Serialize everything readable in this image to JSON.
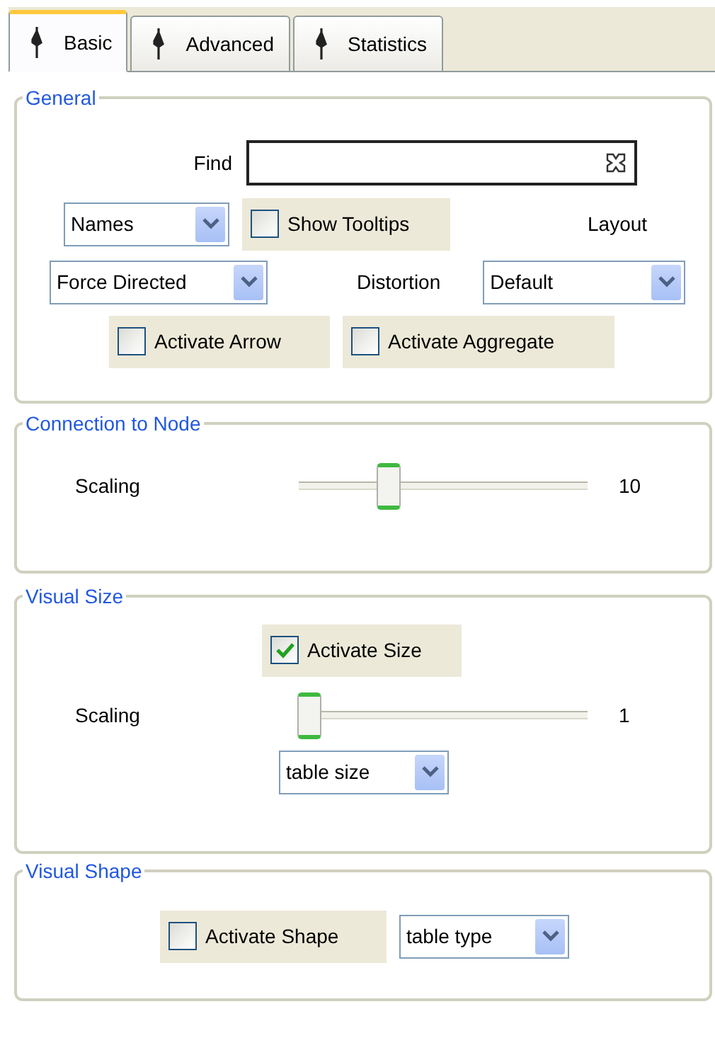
{
  "tabs": [
    {
      "label": "Basic",
      "selected": true
    },
    {
      "label": "Advanced",
      "selected": false
    },
    {
      "label": "Statistics",
      "selected": false
    }
  ],
  "general": {
    "title": "General",
    "find_label": "Find",
    "names_select": "Names",
    "show_tooltips": {
      "label": "Show Tooltips",
      "checked": false
    },
    "layout_label": "Layout",
    "layout_select": "Force Directed",
    "distortion_label": "Distortion",
    "distortion_select": "Default",
    "activate_arrow": {
      "label": "Activate Arrow",
      "checked": false
    },
    "activate_aggregate": {
      "label": "Activate Aggregate",
      "checked": false
    }
  },
  "connection": {
    "title": "Connection to Node",
    "scaling_label": "Scaling",
    "slider": {
      "level": 0.3
    },
    "reading": "10"
  },
  "visual_size": {
    "title": "Visual Size",
    "activate_size": {
      "label": "Activate Size",
      "checked": true
    },
    "scaling_label": "Scaling",
    "slider": {
      "level": 0
    },
    "reading": "1",
    "size_select": "table size"
  },
  "visual_shape": {
    "title": "Visual Shape",
    "activate_shape": {
      "label": "Activate Shape",
      "checked": false
    },
    "type_select": "table type"
  }
}
